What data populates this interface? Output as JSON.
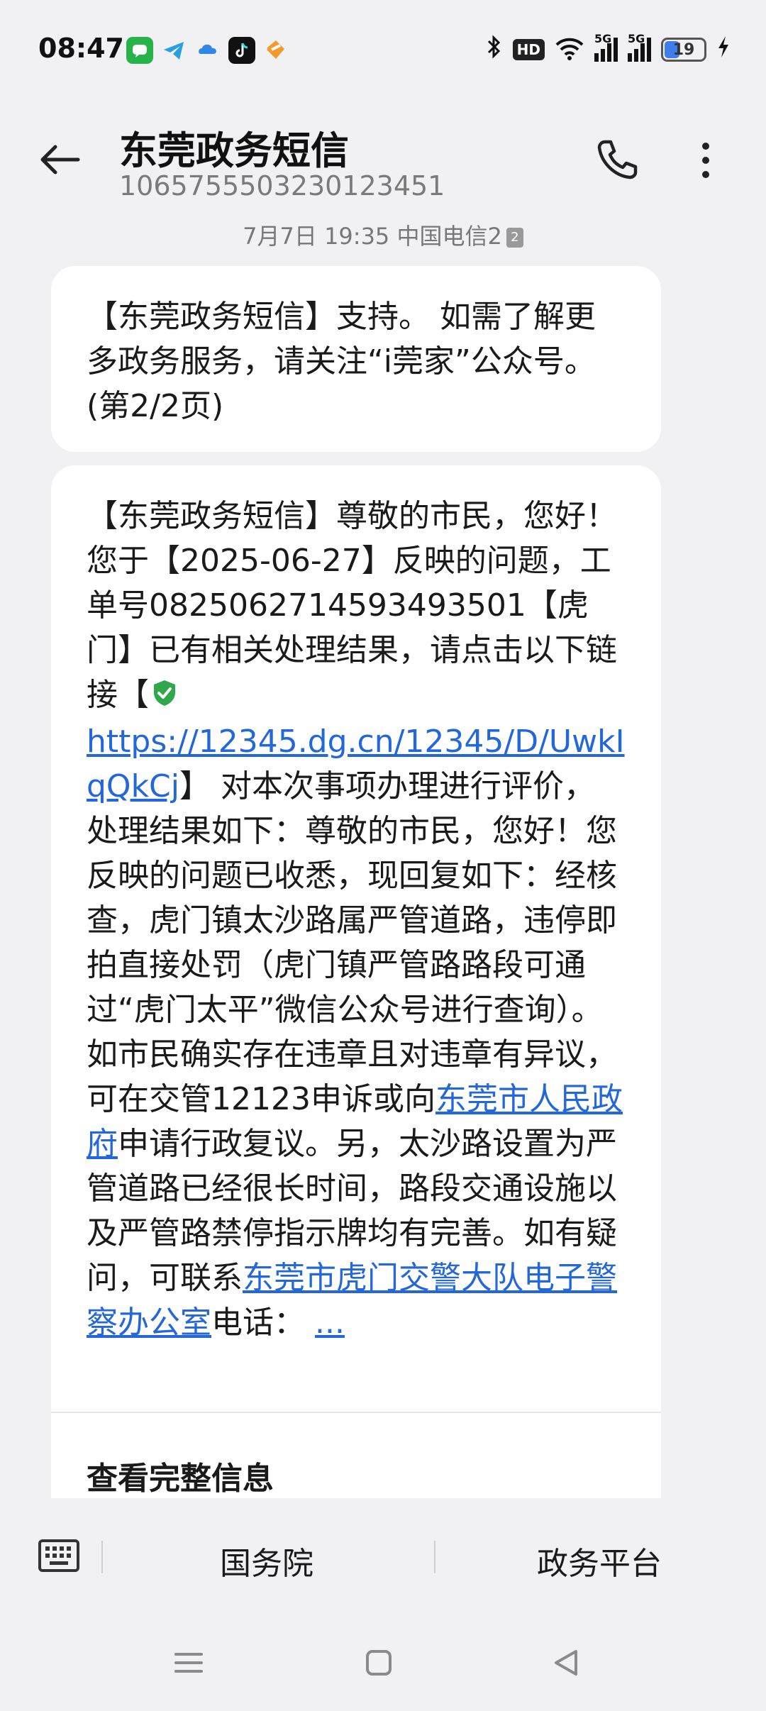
{
  "status_bar": {
    "time": "08:47",
    "hd_label": "HD",
    "signal1_label": "5G",
    "signal2_label": "5G",
    "battery_level": "19",
    "notification_icons": [
      "wechat-icon",
      "telegram-icon",
      "cloud-app-icon",
      "tiktok-icon",
      "heart-app-icon"
    ]
  },
  "header": {
    "title": "东莞政务短信",
    "sender_number": "1065755503230123451"
  },
  "timestamp": {
    "text": "7月7日 19:35 中国电信2",
    "sim_badge": "2"
  },
  "messages": {
    "first": {
      "text": "【东莞政务短信】支持。 如需了解更多政务服务，请关注“i莞家”公众号。(第2/2页)"
    },
    "second": {
      "part1": "【东莞政务短信】尊敬的市民，您好！您于【2025-06-27】反映的问题，工单号0825062714593493501【虎门】已有相关处理结果，请点击以下链接【",
      "link_url": "https://12345.dg.cn/12345/D/UwkIqQkCj",
      "part2": "】 对本次事项办理进行评价，处理结果如下：尊敬的市民，您好！您反映的问题已收悉，现回复如下：经核查，虎门镇太沙路属严管道路，违停即拍直接处罚（虎门镇严管路路段可通过“虎门太平”微信公众号进行查询）。如市民确实存在违章且对违章有异议，可在交管12123申诉或向",
      "link_gov": "东莞市人民政府",
      "part3": "申请行政复议。另，太沙路设置为严管道路已经很长时间，路段交通设施以及严管路禁停指示牌均有完善。如有疑问，可联系",
      "link_police": "东莞市虎门交警大队电子警察办公室",
      "part4": "电话：",
      "more": "..."
    },
    "view_full_label": "查看完整信息"
  },
  "menu": {
    "item1": "国务院",
    "item2": "政务平台"
  },
  "colors": {
    "link": "#2467d8",
    "background": "#f1f1f3",
    "bubble": "#ffffff",
    "shield_green": "#2ea84a",
    "battery_fill": "#3f7ee8"
  }
}
